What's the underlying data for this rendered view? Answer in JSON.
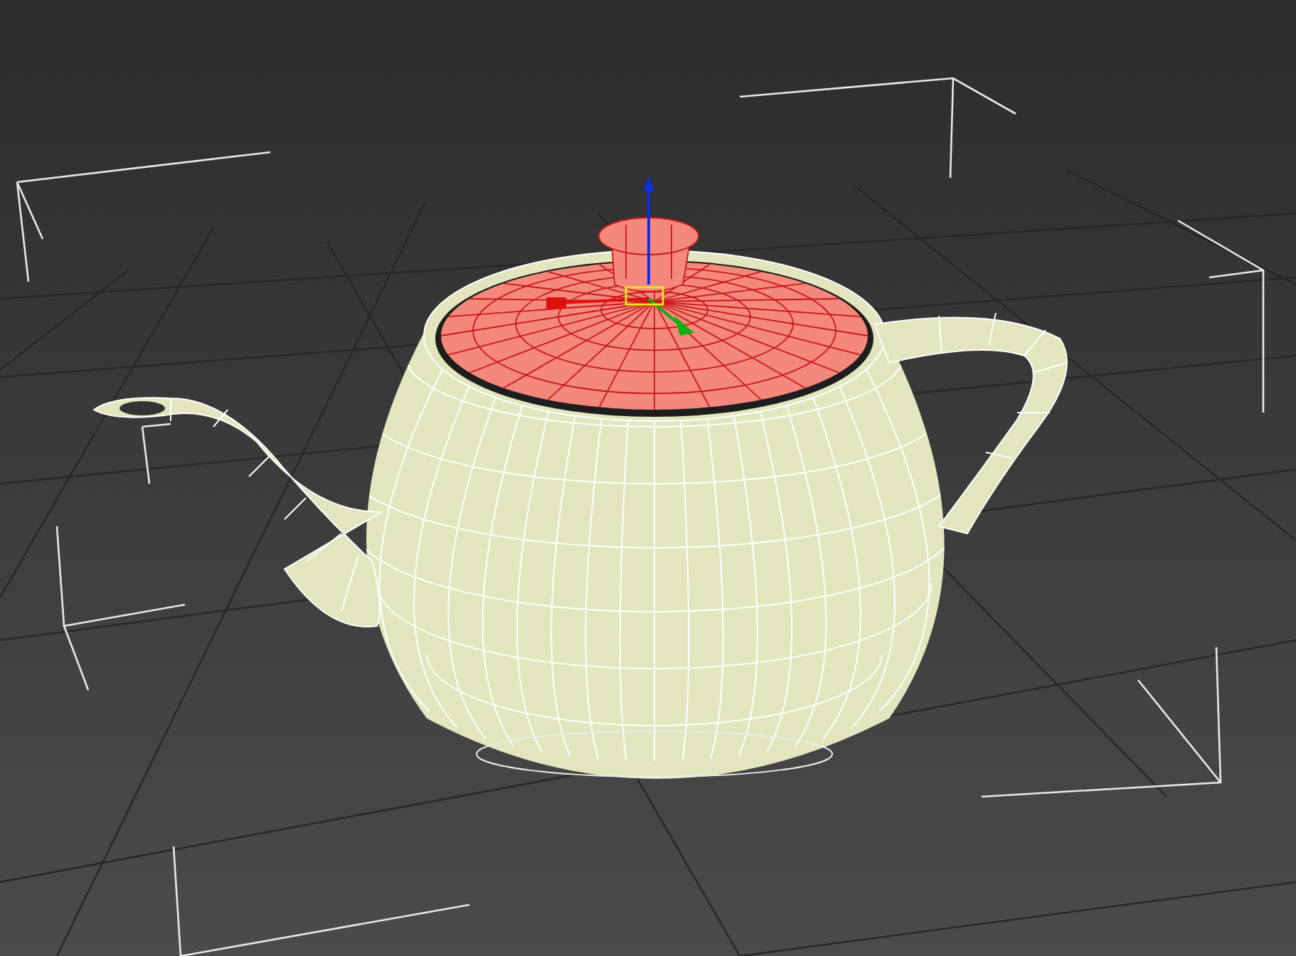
{
  "viewport": {
    "teapot": {
      "parts": [
        {
          "kind": "body",
          "selected": false
        },
        {
          "kind": "spout",
          "selected": false
        },
        {
          "kind": "handle",
          "selected": false
        },
        {
          "kind": "lid",
          "selected": true
        }
      ]
    }
  }
}
